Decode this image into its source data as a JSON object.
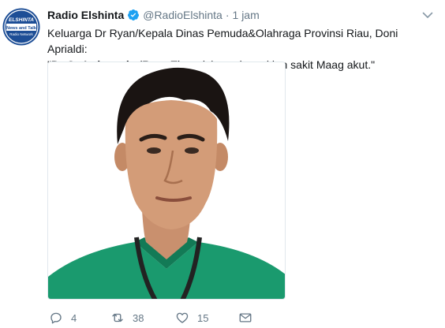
{
  "tweet": {
    "author": {
      "display_name": "Radio Elshinta",
      "handle": "@RadioElshinta",
      "verified": true,
      "avatar_text_top": "ELSHINTA",
      "avatar_text_bottom1": "News and Talk",
      "avatar_text_bottom2": "Radio Network"
    },
    "separator": "·",
    "time": "1 jam",
    "text_line1": "Keluarga Dr Ryan/Kepala Dinas Pemuda&Olahraga Provinsi Riau, Doni Aprialdi:",
    "text_line2_bold": "Dr Oz Indonesia",
    "text_line2_open_quote": "\"",
    "text_line2_rest": " (Ryan Thamrin) meninggal krn sakit Maag akut.\"",
    "actions": {
      "reply_count": "4",
      "retweet_count": "38",
      "like_count": "15"
    }
  },
  "colors": {
    "brand": "#1da1f2",
    "meta": "#657786",
    "scrubs": "#1a9a6e",
    "logo_blue": "#1d4e96"
  },
  "icons": [
    "verified-badge-icon",
    "caret-down-icon",
    "reply-icon",
    "retweet-icon",
    "like-icon",
    "direct-message-icon"
  ]
}
